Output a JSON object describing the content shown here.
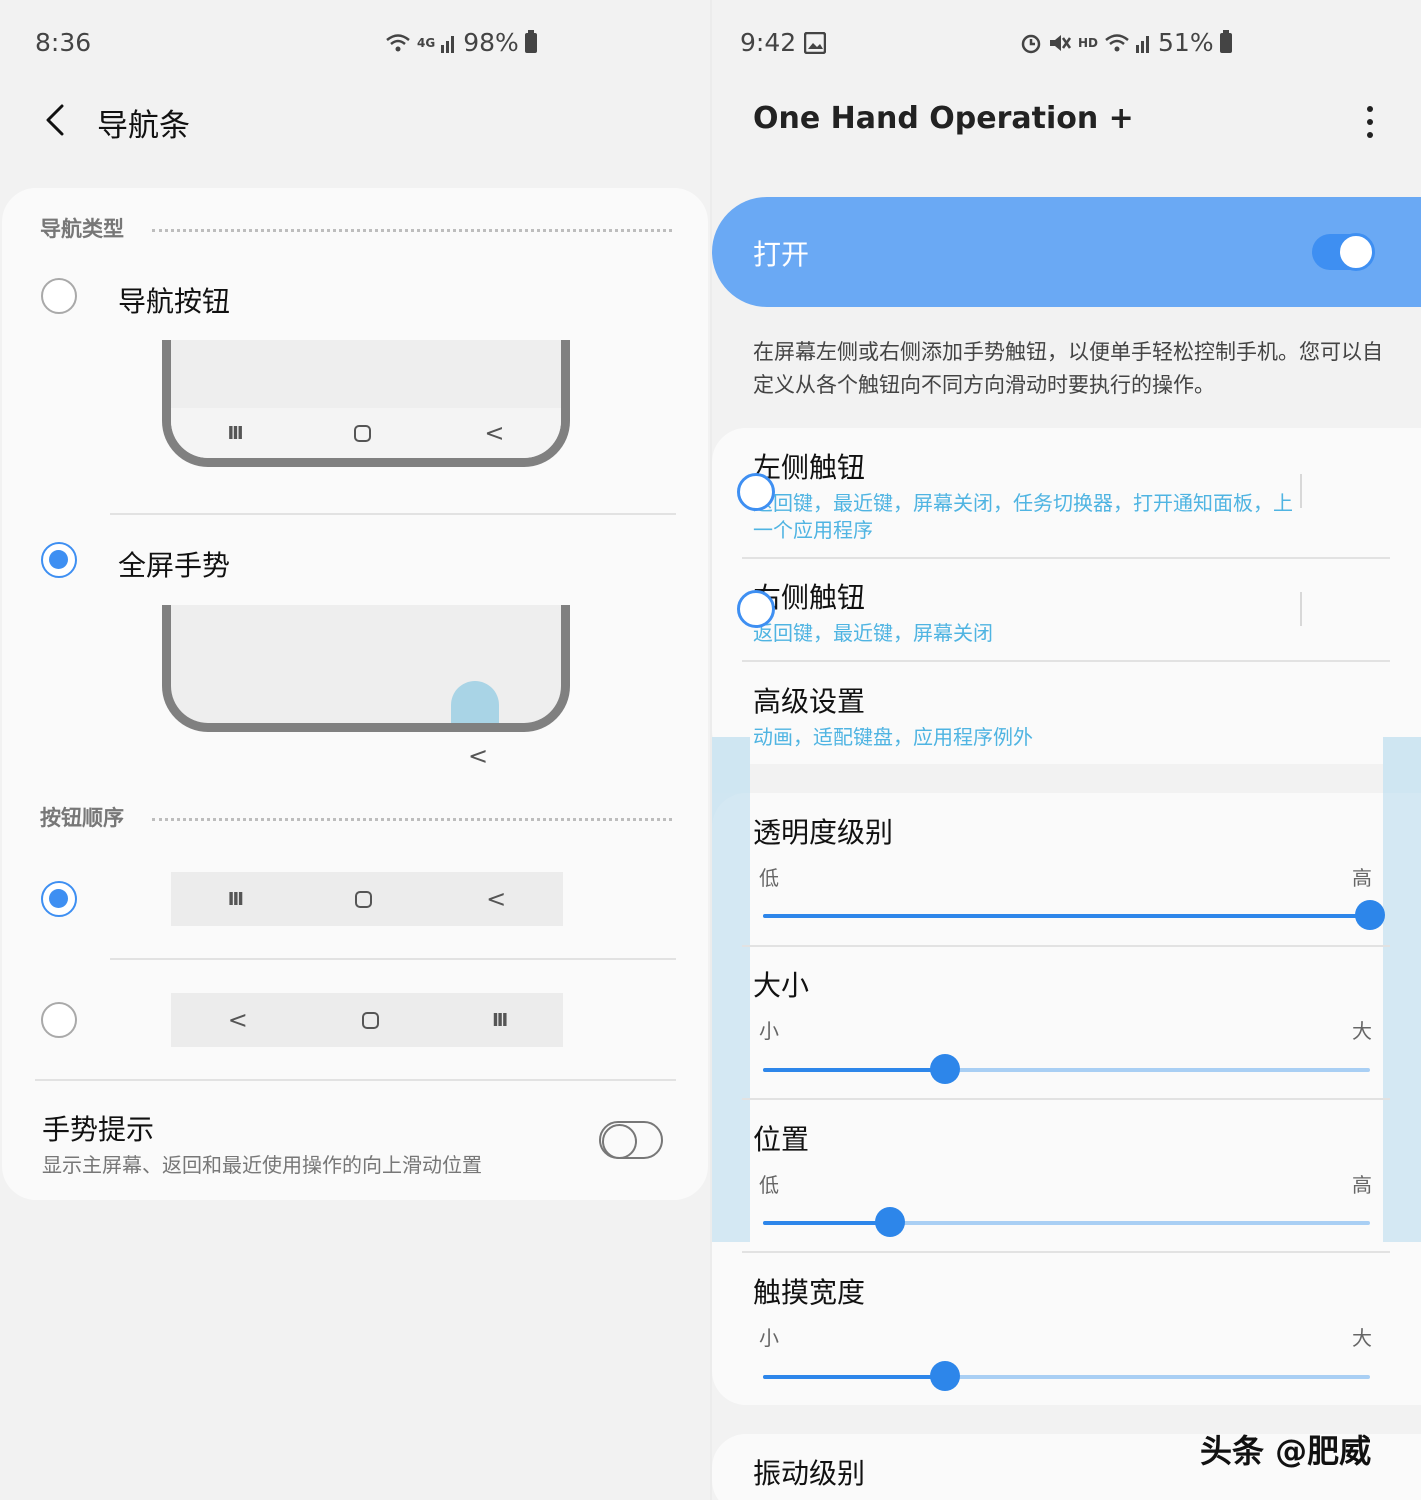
{
  "left_screen": {
    "status": {
      "time": "8:36",
      "network": "4G",
      "battery": "98%"
    },
    "header": {
      "title": "导航条"
    },
    "nav_type": {
      "section_label": "导航类型",
      "options": [
        {
          "label": "导航按钮",
          "selected": false
        },
        {
          "label": "全屏手势",
          "selected": true
        }
      ]
    },
    "button_order": {
      "section_label": "按钮顺序",
      "options": [
        {
          "order": [
            "recent",
            "home",
            "back"
          ],
          "selected": true
        },
        {
          "order": [
            "back",
            "home",
            "recent"
          ],
          "selected": false
        }
      ]
    },
    "gesture_hint": {
      "title": "手势提示",
      "subtitle": "显示主屏幕、返回和最近使用操作的向上滑动位置",
      "enabled": false
    },
    "nav_glyphs": {
      "recent": "III",
      "back": "<"
    }
  },
  "right_screen": {
    "status": {
      "time": "9:42",
      "hd": "HD",
      "battery": "51%"
    },
    "header": {
      "title": "One Hand Operation +"
    },
    "master_switch": {
      "label": "打开",
      "enabled": true
    },
    "description": "在屏幕左侧或右侧添加手势触钮，以便单手轻松控制手机。您可以自定义从各个触钮向不同方向滑动时要执行的操作。",
    "items": [
      {
        "title": "左侧触钮",
        "subtitle": "返回键，最近键，屏幕关闭，任务切换器，打开通知面板，上一个应用程序",
        "enabled": true
      },
      {
        "title": "右侧触钮",
        "subtitle": "返回键，最近键，屏幕关闭",
        "enabled": true
      },
      {
        "title": "高级设置",
        "subtitle": "动画，适配键盘，应用程序例外"
      }
    ],
    "sliders": [
      {
        "title": "透明度级别",
        "min_label": "低",
        "max_label": "高",
        "value": 1.0
      },
      {
        "title": "大小",
        "min_label": "小",
        "max_label": "大",
        "value": 0.3
      },
      {
        "title": "位置",
        "min_label": "低",
        "max_label": "高",
        "value": 0.21
      },
      {
        "title": "触摸宽度",
        "min_label": "小",
        "max_label": "大",
        "value": 0.3
      }
    ],
    "next_section_title": "振动级别"
  },
  "watermark": "头条 @肥威",
  "colors": {
    "accent": "#3e8ff2",
    "master_bg": "#6aa9f4",
    "sub_text": "#4fb4e2"
  }
}
